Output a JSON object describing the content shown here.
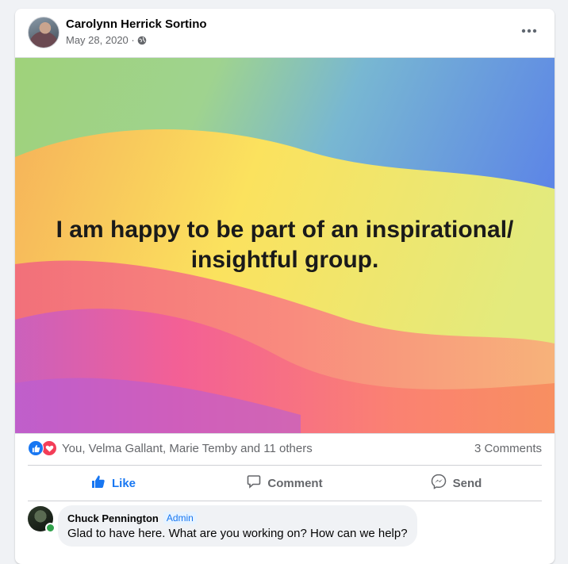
{
  "post": {
    "author": "Carolynn Herrick Sortino",
    "date": "May 28, 2020 ·",
    "privacy_icon": "globe-icon",
    "more_icon": "more-options-icon",
    "banner_text": "I am happy to be part of an inspirational/ insightful group."
  },
  "reactions": {
    "icons": [
      "like-icon",
      "love-icon"
    ],
    "summary": "You, Velma Gallant, Marie Temby and 11 others",
    "comments_count": "3 Comments"
  },
  "actions": {
    "like": "Like",
    "comment": "Comment",
    "send": "Send"
  },
  "comment": {
    "author": "Chuck Pennington",
    "badge": "Admin",
    "text": "Glad to have here. What are you working on? How can we help?"
  },
  "colors": {
    "accent": "#1877f2",
    "love": "#f33e58",
    "online": "#31a24c",
    "muted_text": "#65676b"
  }
}
